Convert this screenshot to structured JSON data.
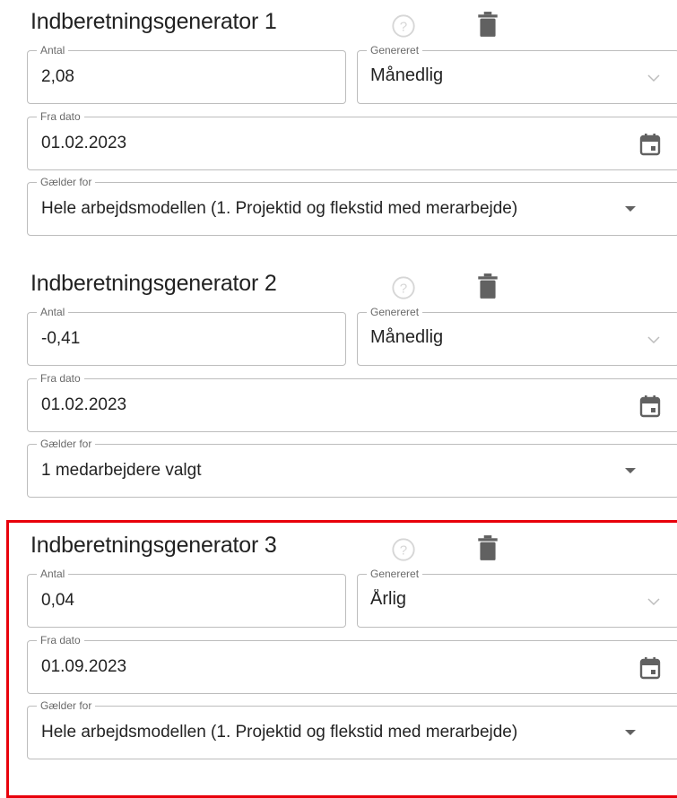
{
  "generators": [
    {
      "title": "Indberetningsgenerator 1",
      "antal_label": "Antal",
      "antal_value": "2,08",
      "genereret_label": "Genereret",
      "genereret_value": "Månedlig",
      "fra_dato_label": "Fra dato",
      "fra_dato_value": "01.02.2023",
      "gaelder_label": "Gælder for",
      "gaelder_value": "Hele arbejdsmodellen (1. Projektid og flekstid med merarbejde)"
    },
    {
      "title": "Indberetningsgenerator 2",
      "antal_label": "Antal",
      "antal_value": "-0,41",
      "genereret_label": "Genereret",
      "genereret_value": "Månedlig",
      "fra_dato_label": "Fra dato",
      "fra_dato_value": "01.02.2023",
      "gaelder_label": "Gælder for",
      "gaelder_value": "1 medarbejdere valgt"
    },
    {
      "title": "Indberetningsgenerator 3",
      "antal_label": "Antal",
      "antal_value": "0,04",
      "genereret_label": "Genereret",
      "genereret_value": "Årlig",
      "fra_dato_label": "Fra dato",
      "fra_dato_value": "01.09.2023",
      "gaelder_label": "Gælder for",
      "gaelder_value": "Hele arbejdsmodellen (1. Projektid og flekstid med merarbejde)"
    }
  ],
  "icons": {
    "help": "help-circle-icon",
    "delete": "trash-icon",
    "calendar": "calendar-icon",
    "chevron": "chevron-down-icon",
    "dropdown": "arrow-drop-down-icon"
  },
  "colors": {
    "highlight": "#e8000b",
    "icon_dark": "#616161",
    "icon_light": "#d6d6d6",
    "border": "#bdbdbd"
  }
}
